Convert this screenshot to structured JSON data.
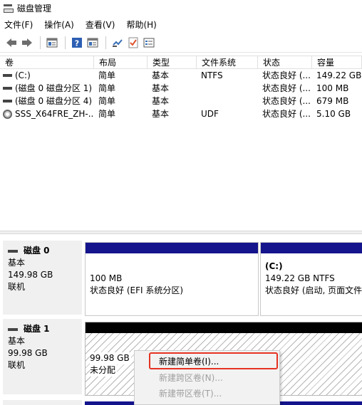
{
  "window": {
    "title": "磁盘管理"
  },
  "menu": [
    "文件(F)",
    "操作(A)",
    "查看(V)",
    "帮助(H)"
  ],
  "toolbar": {
    "icons": [
      "back-arrow-icon",
      "forward-arrow-icon",
      "disk-list-icon",
      "help-icon",
      "view-icon",
      "connect-icon",
      "check-icon",
      "properties-icon"
    ]
  },
  "volumes": {
    "headers": [
      "卷",
      "布局",
      "类型",
      "文件系统",
      "状态",
      "容量"
    ],
    "rows": [
      {
        "name": "(C:)",
        "layout": "简单",
        "type": "基本",
        "fs": "NTFS",
        "status": "状态良好 (...",
        "capacity": "149.22 GB"
      },
      {
        "name": "(磁盘 0 磁盘分区 1)",
        "layout": "简单",
        "type": "基本",
        "fs": "",
        "status": "状态良好 (...",
        "capacity": "100 MB"
      },
      {
        "name": "(磁盘 0 磁盘分区 4)",
        "layout": "简单",
        "type": "基本",
        "fs": "",
        "status": "状态良好 (...",
        "capacity": "679 MB"
      },
      {
        "name": "SSS_X64FRE_ZH-...",
        "layout": "简单",
        "type": "基本",
        "fs": "UDF",
        "status": "状态良好 (...",
        "capacity": "5.10 GB"
      }
    ]
  },
  "disks": [
    {
      "name": "磁盘 0",
      "kind": "基本",
      "size": "149.98 GB",
      "state": "联机",
      "partitions": [
        {
          "title": "",
          "size": "100 MB",
          "desc": "状态良好 (EFI 系统分区)"
        },
        {
          "title": "(C:)",
          "size": "149.22 GB NTFS",
          "desc": "状态良好 (启动, 页面文件"
        }
      ]
    },
    {
      "name": "磁盘 1",
      "kind": "基本",
      "size": "99.98 GB",
      "state": "联机",
      "partitions": [
        {
          "size": "99.98 GB",
          "desc": "未分配"
        }
      ]
    }
  ],
  "context_menu": {
    "items": [
      {
        "label": "新建简单卷(I)...",
        "enabled": true,
        "highlighted": true
      },
      {
        "label": "新建跨区卷(N)...",
        "enabled": false
      },
      {
        "label": "新建带区卷(T)...",
        "enabled": false
      }
    ]
  },
  "colors": {
    "primary_bar": "#14148c",
    "unallocated_bar": "#000000",
    "highlight_box": "#e53222"
  }
}
